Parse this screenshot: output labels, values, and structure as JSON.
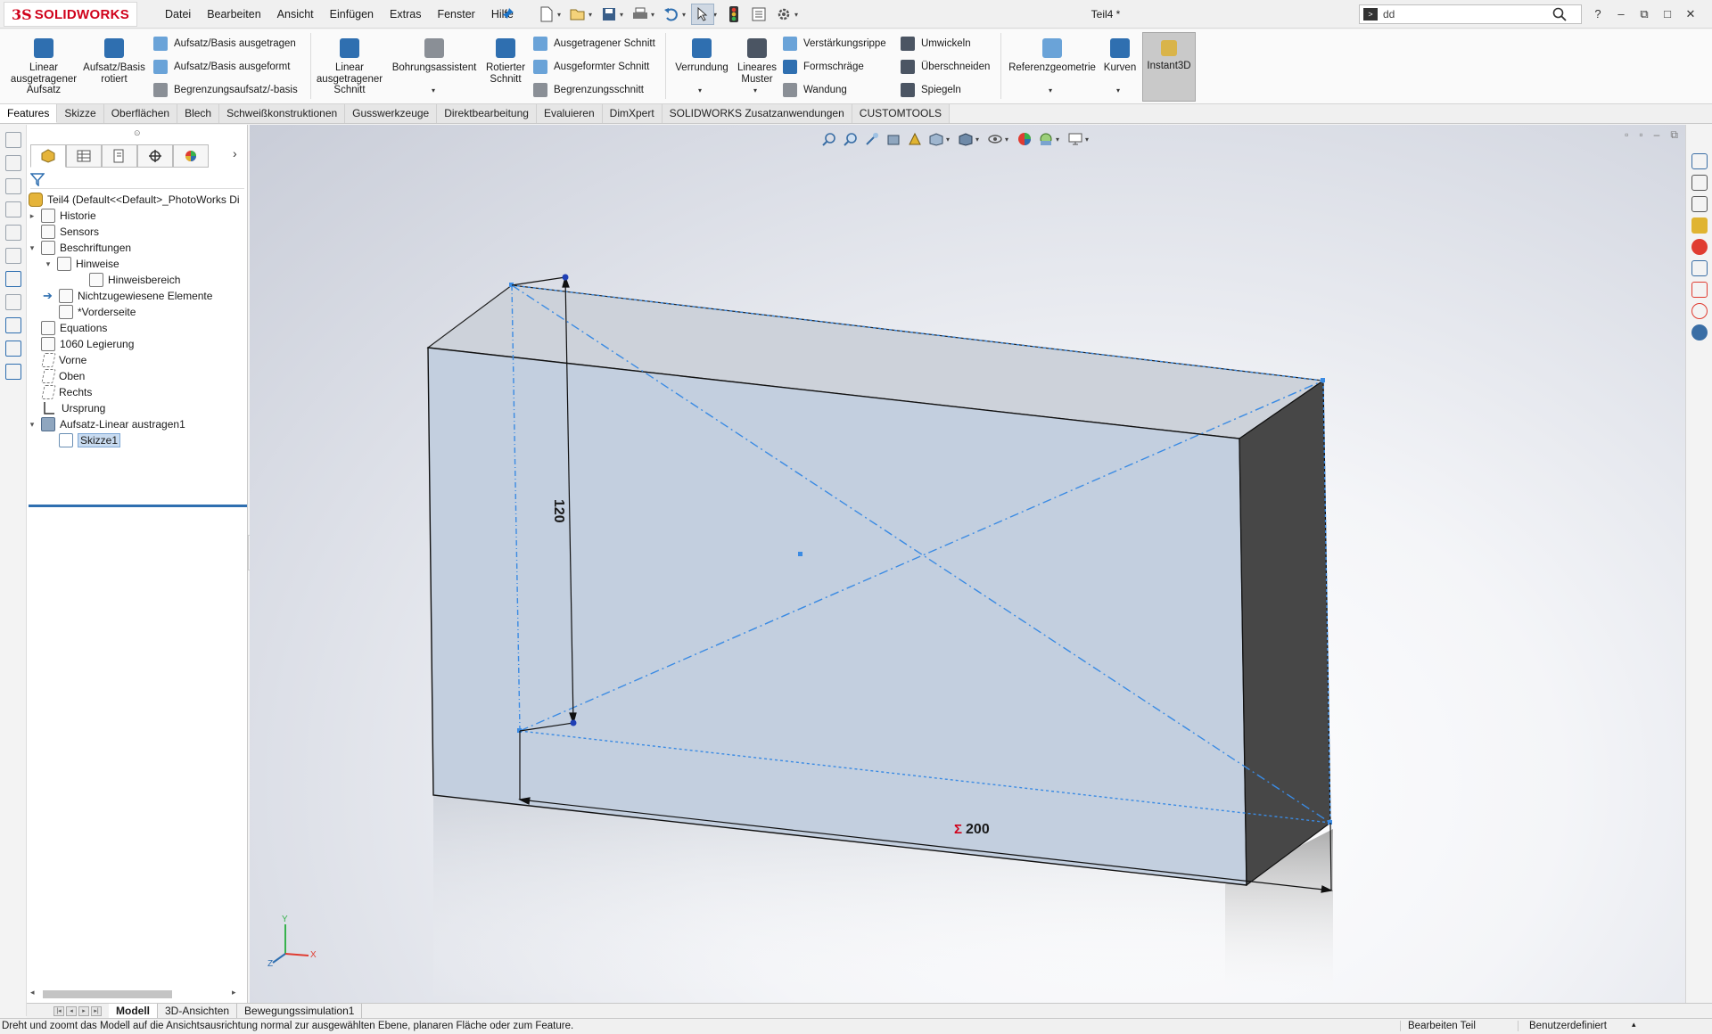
{
  "app": {
    "logo_prefix": "3S",
    "logo_name": "SOLIDWORKS",
    "document_title": "Teil4 *"
  },
  "menu": [
    "Datei",
    "Bearbeiten",
    "Ansicht",
    "Einfügen",
    "Extras",
    "Fenster",
    "Hilfe"
  ],
  "search": {
    "value": "dd",
    "placeholder": ""
  },
  "window_controls": [
    "?",
    "–",
    "⧉",
    "□",
    "✕"
  ],
  "command_manager": {
    "linear_boss": "Linear ausgetragener Aufsatz",
    "revolved_boss": "Aufsatz/Basis rotiert",
    "swept_boss": "Aufsatz/Basis ausgetragen",
    "lofted_boss": "Aufsatz/Basis ausgeformt",
    "boundary_boss": "Begrenzungsaufsatz/-basis",
    "extruded_cut": "Linear ausgetragener Schnitt",
    "hole_wizard": "Bohrungsassistent",
    "revolved_cut": "Rotierter Schnitt",
    "swept_cut": "Ausgetragener Schnitt",
    "lofted_cut": "Ausgeformter Schnitt",
    "boundary_cut": "Begrenzungsschnitt",
    "fillet": "Verrundung",
    "linear_pattern": "Lineares Muster",
    "rib": "Verstärkungsrippe",
    "draft": "Formschräge",
    "shell": "Wandung",
    "wrap": "Umwickeln",
    "intersect": "Überschneiden",
    "mirror": "Spiegeln",
    "reference_geometry": "Referenzgeometrie",
    "curves": "Kurven",
    "instant3d": "Instant3D"
  },
  "tabs": [
    "Features",
    "Skizze",
    "Oberflächen",
    "Blech",
    "Schweißkonstruktionen",
    "Gusswerkzeuge",
    "Direktbearbeitung",
    "Evaluieren",
    "DimXpert",
    "SOLIDWORKS Zusatzanwendungen",
    "CUSTOMTOOLS"
  ],
  "active_tab": "Features",
  "tree": {
    "root": "Teil4  (Default<<Default>_PhotoWorks Di",
    "items": [
      "Historie",
      "Sensors",
      "Beschriftungen",
      "Hinweise",
      "Hinweisbereich",
      "Nichtzugewiesene Elemente",
      "*Vorderseite",
      "Equations",
      "1060 Legierung",
      "Vorne",
      "Oben",
      "Rechts",
      "Ursprung",
      "Aufsatz-Linear austragen1",
      "Skizze1"
    ]
  },
  "model": {
    "dimension_height": "120",
    "dimension_width": "200",
    "dimension_symbol": "Σ",
    "triad_labels": [
      "Y",
      "X",
      "Z"
    ]
  },
  "bottom_tabs": [
    "Modell",
    "3D-Ansichten",
    "Bewegungssimulation1"
  ],
  "status": {
    "message": "Dreht und zoomt das Modell auf die Ansichtsausrichtung normal zur ausgewählten Ebene, planaren Fläche oder zum Feature.",
    "mode": "Bearbeiten Teil",
    "units": "Benutzerdefiniert"
  },
  "colors": {
    "brand_red": "#d0021b",
    "selection_blue": "#2f6fb0",
    "sketch_blue": "#3b8be3",
    "face_fill": "#c3cfdf",
    "side_face": "#474747"
  }
}
